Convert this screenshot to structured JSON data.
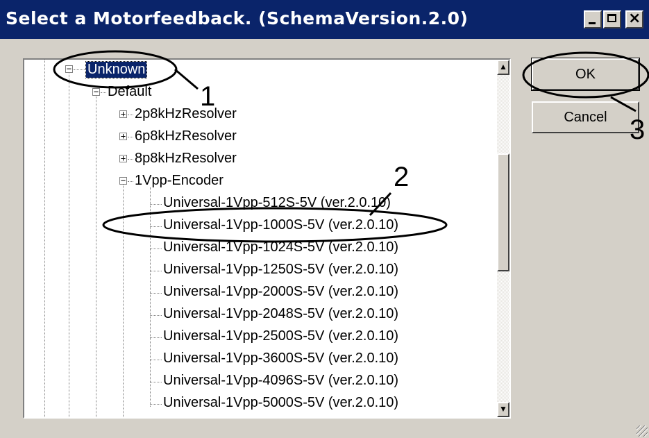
{
  "window": {
    "title": "Select a Motorfeedback. (SchemaVersion.2.0)",
    "controls": {
      "minimize": "_",
      "maximize": "□",
      "close": "×"
    }
  },
  "tree": {
    "root": "Unknown",
    "group": "Default",
    "items": [
      {
        "label": "2p8kHzResolver",
        "expander": "+"
      },
      {
        "label": "6p8kHzResolver",
        "expander": "+"
      },
      {
        "label": "8p8kHzResolver",
        "expander": "+"
      },
      {
        "label": "1Vpp-Encoder",
        "expander": "−"
      }
    ],
    "encoders": [
      "Universal-1Vpp-512S-5V (ver.2.0.10)",
      "Universal-1Vpp-1000S-5V (ver.2.0.10)",
      "Universal-1Vpp-1024S-5V (ver.2.0.10)",
      "Universal-1Vpp-1250S-5V (ver.2.0.10)",
      "Universal-1Vpp-2000S-5V (ver.2.0.10)",
      "Universal-1Vpp-2048S-5V (ver.2.0.10)",
      "Universal-1Vpp-2500S-5V (ver.2.0.10)",
      "Universal-1Vpp-3600S-5V (ver.2.0.10)",
      "Universal-1Vpp-4096S-5V (ver.2.0.10)",
      "Universal-1Vpp-5000S-5V (ver.2.0.10)"
    ],
    "scroll": {
      "up": "▲",
      "down": "▼"
    }
  },
  "buttons": {
    "ok": "OK",
    "cancel": "Cancel"
  },
  "annotations": {
    "one": "1",
    "two": "2",
    "three": "3"
  }
}
